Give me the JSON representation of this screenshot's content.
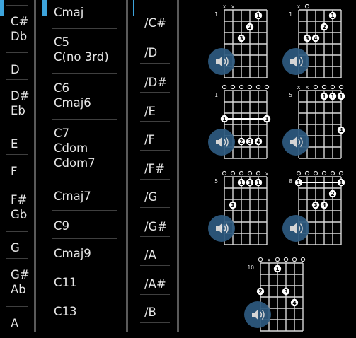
{
  "roots": [
    {
      "label": "C#\nDb"
    },
    {
      "label": "D"
    },
    {
      "label": "D#\nEb"
    },
    {
      "label": "E"
    },
    {
      "label": "F"
    },
    {
      "label": "F#\nGb"
    },
    {
      "label": "G"
    },
    {
      "label": "G#\nAb"
    },
    {
      "label": "A"
    }
  ],
  "chord_types": [
    {
      "label": "Cmaj"
    },
    {
      "label": "C5\nC(no 3rd)"
    },
    {
      "label": "C6\nCmaj6"
    },
    {
      "label": "C7\nCdom\nCdom7"
    },
    {
      "label": "Cmaj7"
    },
    {
      "label": "C9"
    },
    {
      "label": "Cmaj9"
    },
    {
      "label": "C11"
    },
    {
      "label": "C13"
    }
  ],
  "bass_notes": [
    {
      "label": "/C#"
    },
    {
      "label": "/D"
    },
    {
      "label": "/D#"
    },
    {
      "label": "/E"
    },
    {
      "label": "/F"
    },
    {
      "label": "/F#"
    },
    {
      "label": "/G"
    },
    {
      "label": "/G#"
    },
    {
      "label": "/A"
    },
    {
      "label": "/A#"
    },
    {
      "label": "/B"
    }
  ],
  "colors": {
    "accent": "#3da4dc",
    "play_button": "#2e5b80",
    "background": "#000000",
    "text": "#e6e6e6"
  },
  "diagrams": [
    {
      "fret": "1",
      "marks": [
        "x",
        "x",
        "",
        "",
        "",
        ""
      ],
      "dots": [
        {
          "s": 4,
          "f": 1,
          "t": "1"
        },
        {
          "s": 3,
          "f": 2,
          "t": "2"
        },
        {
          "s": 2,
          "f": 3,
          "t": "3"
        }
      ],
      "barre": null,
      "play_icon": "speaker-icon"
    },
    {
      "fret": "1",
      "marks": [
        "x",
        "o",
        "",
        "",
        "",
        ""
      ],
      "dots": [
        {
          "s": 4,
          "f": 1,
          "t": "1"
        },
        {
          "s": 3,
          "f": 2,
          "t": "2"
        },
        {
          "s": 1,
          "f": 3,
          "t": "3"
        },
        {
          "s": 2,
          "f": 3,
          "t": "4"
        }
      ],
      "barre": null,
      "play_icon": "speaker-icon"
    },
    {
      "fret": "1",
      "marks": [
        "o",
        "o",
        "o",
        "o",
        "o",
        "o"
      ],
      "dots": [
        {
          "s": 2,
          "f": 5,
          "t": "2"
        },
        {
          "s": 3,
          "f": 5,
          "t": "3"
        },
        {
          "s": 4,
          "f": 5,
          "t": "4"
        }
      ],
      "barre": {
        "f": 3,
        "from": 0,
        "to": 5,
        "t": "1"
      },
      "play_icon": "speaker-icon"
    },
    {
      "fret": "5",
      "marks": [
        "x",
        "x",
        "o",
        "o",
        "o",
        "o"
      ],
      "dots": [
        {
          "s": 3,
          "f": 1,
          "t": "1"
        },
        {
          "s": 4,
          "f": 1,
          "t": "1"
        },
        {
          "s": 5,
          "f": 1,
          "t": "1"
        },
        {
          "s": 5,
          "f": 4,
          "t": "4"
        }
      ],
      "barre": null,
      "play_icon": "speaker-icon"
    },
    {
      "fret": "5",
      "marks": [
        "o",
        "o",
        "o",
        "o",
        "o",
        "x"
      ],
      "dots": [
        {
          "s": 2,
          "f": 1,
          "t": "1"
        },
        {
          "s": 3,
          "f": 1,
          "t": "1"
        },
        {
          "s": 4,
          "f": 1,
          "t": "1"
        },
        {
          "s": 1,
          "f": 3,
          "t": "3"
        },
        {
          "s": 0,
          "f": 5,
          "t": "4"
        }
      ],
      "barre": null,
      "play_icon": "speaker-icon"
    },
    {
      "fret": "8",
      "marks": [
        "o",
        "o",
        "o",
        "o",
        "o",
        "o"
      ],
      "dots": [
        {
          "s": 4,
          "f": 2,
          "t": "2"
        },
        {
          "s": 2,
          "f": 3,
          "t": "3"
        },
        {
          "s": 3,
          "f": 3,
          "t": "4"
        }
      ],
      "barre": {
        "f": 1,
        "from": 0,
        "to": 5,
        "t": "1"
      },
      "play_icon": "speaker-icon"
    },
    {
      "fret": "10",
      "marks": [
        "o",
        "x",
        "o",
        "o",
        "o",
        "o"
      ],
      "dots": [
        {
          "s": 2,
          "f": 1,
          "t": "1"
        },
        {
          "s": 0,
          "f": 3,
          "t": "2"
        },
        {
          "s": 3,
          "f": 3,
          "t": "3"
        },
        {
          "s": 4,
          "f": 4,
          "t": "4"
        }
      ],
      "barre": null,
      "play_icon": "speaker-icon"
    }
  ]
}
